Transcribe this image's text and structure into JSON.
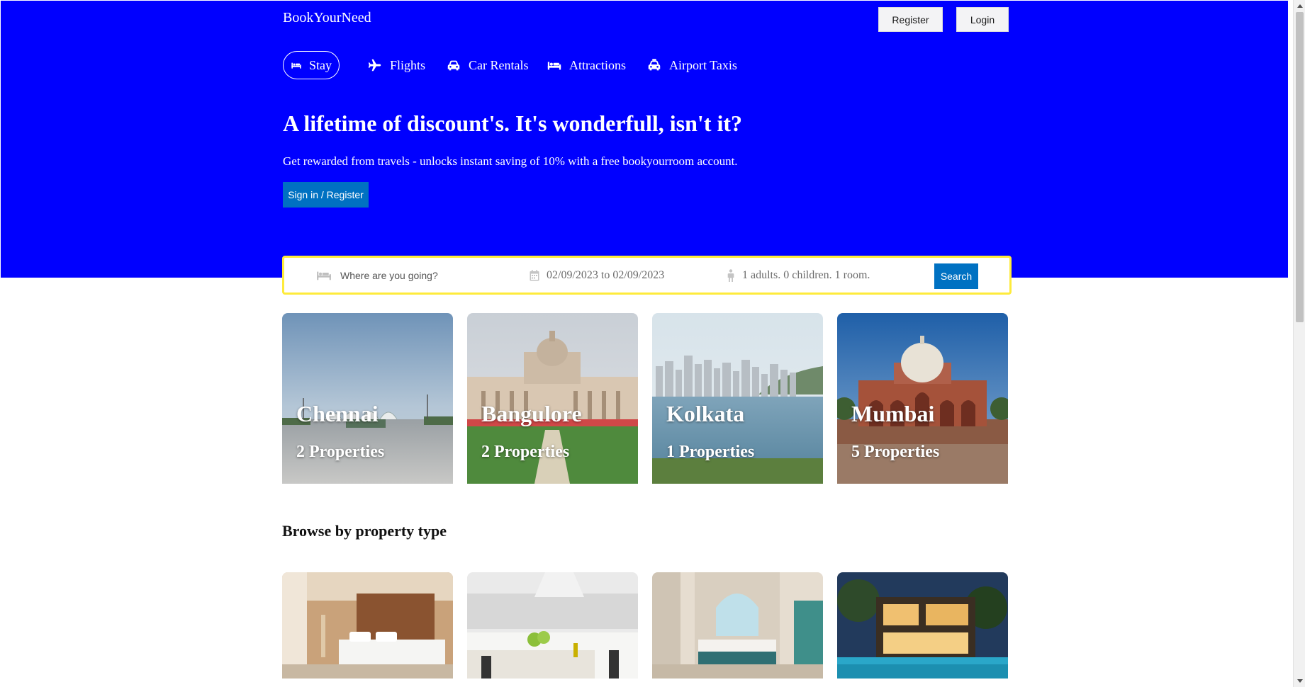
{
  "header": {
    "logo": "BookYourNeed",
    "register_label": "Register",
    "login_label": "Login"
  },
  "nav": {
    "items": [
      {
        "label": "Stay",
        "icon": "bed-icon",
        "active": true
      },
      {
        "label": "Flights",
        "icon": "plane-icon",
        "active": false
      },
      {
        "label": "Car Rentals",
        "icon": "car-icon",
        "active": false
      },
      {
        "label": "Attractions",
        "icon": "bed-icon",
        "active": false
      },
      {
        "label": "Airport Taxis",
        "icon": "taxi-icon",
        "active": false
      }
    ]
  },
  "hero": {
    "title": "A lifetime of discount's. It's wonderfull, isn't it?",
    "subtitle": "Get rewarded from travels - unlocks instant saving of 10% with a free bookyourroom account.",
    "cta_label": "Sign in / Register"
  },
  "search": {
    "destination_placeholder": "Where are you going?",
    "dates": "02/09/2023 to 02/09/2023",
    "guests": "1 adults. 0 children. 1 room.",
    "button_label": "Search"
  },
  "cities": [
    {
      "name": "Chennai",
      "properties": "2 Properties"
    },
    {
      "name": "Bangulore",
      "properties": "2 Properties"
    },
    {
      "name": "Kolkata",
      "properties": "1 Properties"
    },
    {
      "name": "Mumbai",
      "properties": "5 Properties"
    }
  ],
  "property_types": {
    "title": "Browse by property type"
  },
  "colors": {
    "hero_bg": "#0000ff",
    "primary_button": "#0071c2",
    "search_border": "#feeb3b"
  }
}
